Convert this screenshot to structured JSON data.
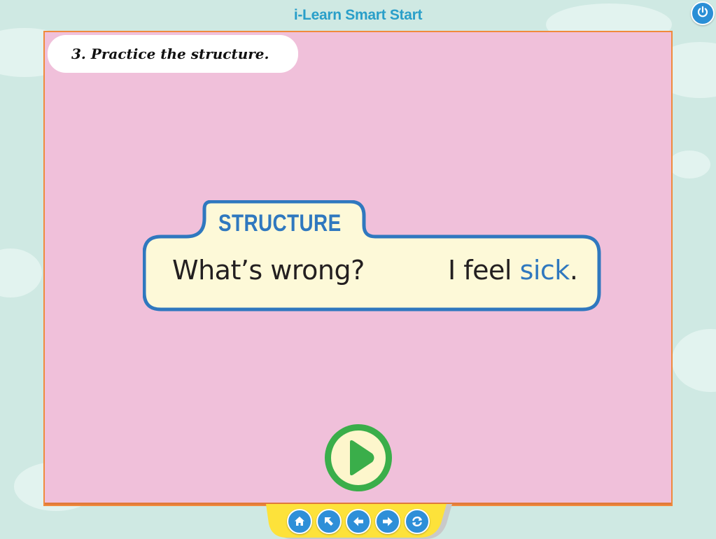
{
  "app": {
    "title": "i-Learn Smart Start"
  },
  "colors": {
    "background": "#cfe9e3",
    "stage": "#f0c0da",
    "stage_border": "#f08a3c",
    "accent_blue": "#2f78bf",
    "title_blue": "#2a9fc9",
    "card_fill": "#fdf9d8",
    "play_green": "#3aae4a",
    "nav_yellow": "#fde23a"
  },
  "instruction": {
    "label": "3. Practice the structure."
  },
  "structure": {
    "title": "STRUCTURE",
    "question": "What’s wrong?",
    "answer_prefix": "I feel ",
    "answer_keyword": "sick",
    "answer_suffix": "."
  },
  "icons": {
    "power": "power-icon",
    "play": "play-icon",
    "home": "home-icon",
    "menu": "arrow-up-left-icon",
    "back": "arrow-left-icon",
    "next": "arrow-right-icon",
    "replay": "refresh-icon"
  }
}
